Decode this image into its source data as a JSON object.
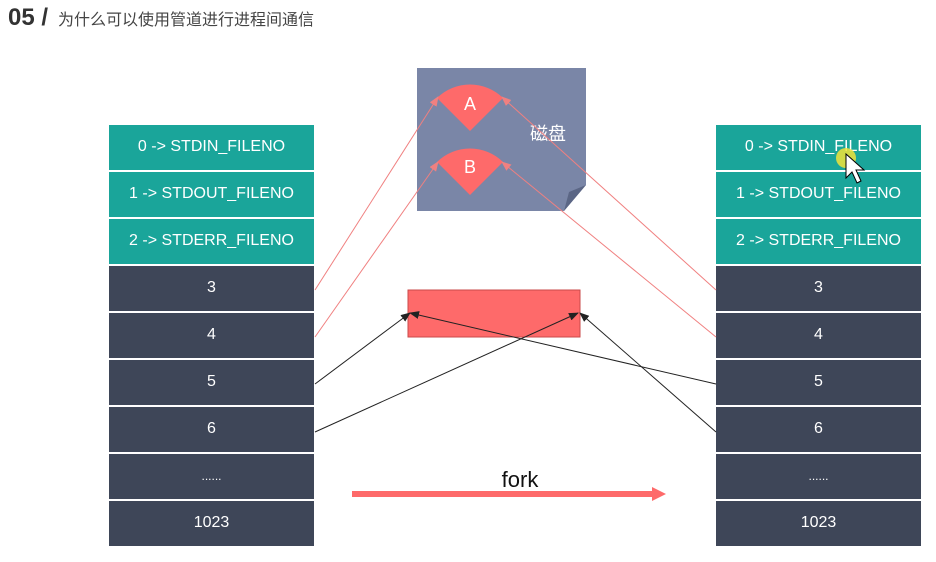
{
  "header": {
    "number": "05 /",
    "title": "为什么可以使用管道进行进程间通信"
  },
  "disk": {
    "label": "磁盘",
    "file_a": "A",
    "file_b": "B"
  },
  "fork_label": "fork",
  "fd_table": [
    "0 -> STDIN_FILENO",
    "1 -> STDOUT_FILENO",
    "2 -> STDERR_FILENO",
    "3",
    "4",
    "5",
    "6",
    "......",
    "1023"
  ],
  "colors": {
    "std": "#1aa59a",
    "fd": "#3e4658",
    "pipe": "#fe6a6a",
    "disk": "#7a86a7"
  }
}
